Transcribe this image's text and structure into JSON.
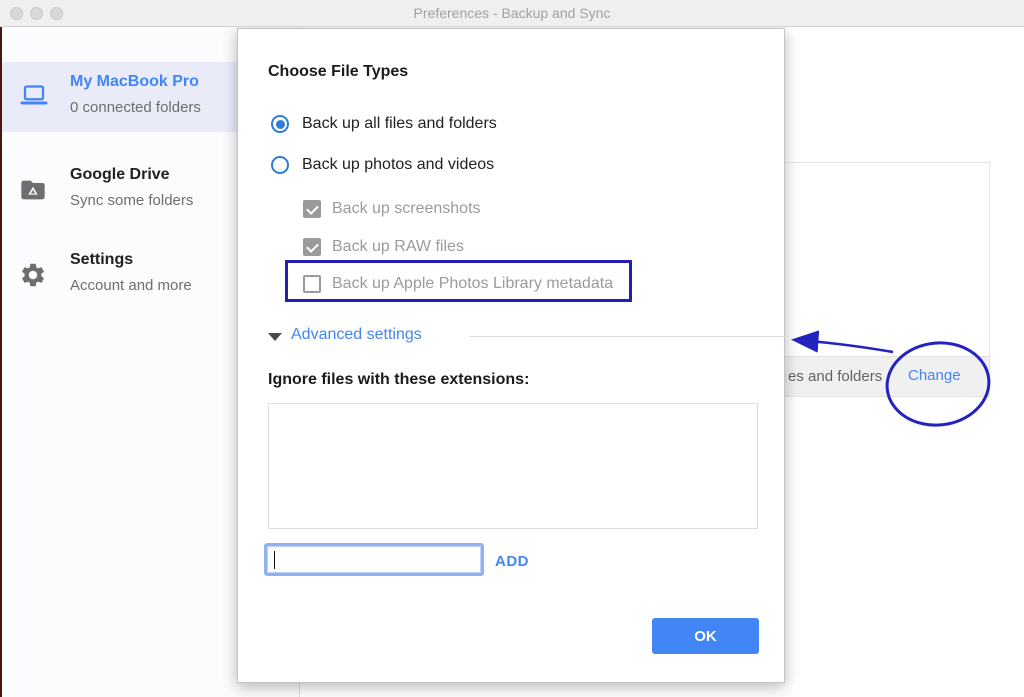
{
  "window": {
    "title": "Preferences - Backup and Sync",
    "traffic_lights": [
      "close",
      "minimize",
      "zoom"
    ]
  },
  "sidebar": {
    "items": [
      {
        "icon": "laptop-icon",
        "title": "My MacBook Pro",
        "subtitle": "0 connected folders",
        "selected": true
      },
      {
        "icon": "google-drive-icon",
        "title": "Google Drive",
        "subtitle": "Sync some folders",
        "selected": false
      },
      {
        "icon": "gear-icon",
        "title": "Settings",
        "subtitle": "Account and more",
        "selected": false
      }
    ]
  },
  "dialog": {
    "title": "Choose File Types",
    "radios": [
      {
        "label": "Back up all files and folders",
        "selected": true
      },
      {
        "label": "Back up photos and videos",
        "selected": false
      }
    ],
    "checkboxes": [
      {
        "label": "Back up screenshots",
        "checked": true
      },
      {
        "label": "Back up RAW files",
        "checked": true
      },
      {
        "label": "Back up Apple Photos Library metadata",
        "checked": false
      }
    ],
    "advanced_label": "Advanced settings",
    "advanced_expanded": true,
    "ignore_label": "Ignore files with these extensions:",
    "extensions_list_value": "",
    "extension_input_value": "",
    "add_label": "ADD",
    "ok_label": "OK"
  },
  "background_window": {
    "partial_text": "es and folders",
    "change_label": "Change"
  },
  "annotations": {
    "highlight_rect_target": "Back up Apple Photos Library metadata checkbox",
    "circle_target": "Change button",
    "color": "#2323c0"
  },
  "colors": {
    "accent_blue": "#4285f4",
    "annotation_blue": "#2020b8",
    "selected_row_bg": "#e9ecf8",
    "checked_gray": "#9a9a9a",
    "ok_button_bg": "#4285f4"
  }
}
